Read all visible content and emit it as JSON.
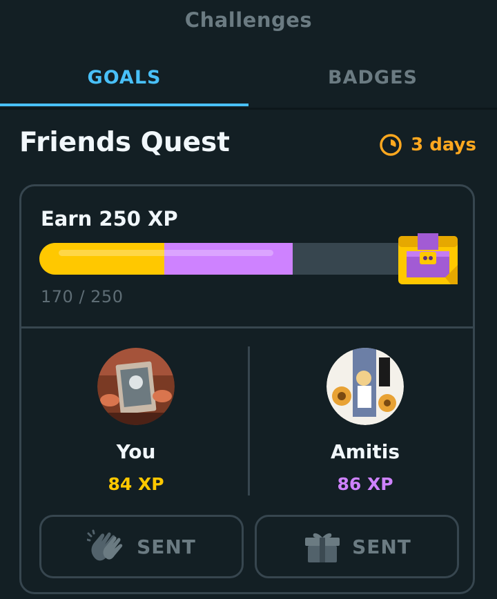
{
  "header": {
    "title": "Challenges"
  },
  "tabs": [
    {
      "label": "GOALS",
      "active": true
    },
    {
      "label": "BADGES",
      "active": false
    }
  ],
  "quest": {
    "title": "Friends Quest",
    "time_left": "3 days",
    "timer_icon": "stopwatch-icon",
    "goal_label": "Earn 250 XP",
    "progress_text": "170 / 250",
    "progress": {
      "total": 250,
      "you": 84,
      "friend": 86
    },
    "reward_icon": "treasure-chest-icon"
  },
  "players": [
    {
      "name": "You",
      "xp": "84 XP",
      "color": "#ffc800"
    },
    {
      "name": "Amitis",
      "xp": "86 XP",
      "color": "#ce82ff"
    }
  ],
  "actions": [
    {
      "label": "SENT",
      "icon": "clapping-hands-icon"
    },
    {
      "label": "SENT",
      "icon": "gift-icon"
    }
  ],
  "colors": {
    "background": "#131f24",
    "accent_blue": "#49c0f8",
    "gold": "#ffc800",
    "purple": "#ce82ff",
    "orange": "#ffa81f",
    "border": "#37464f"
  }
}
